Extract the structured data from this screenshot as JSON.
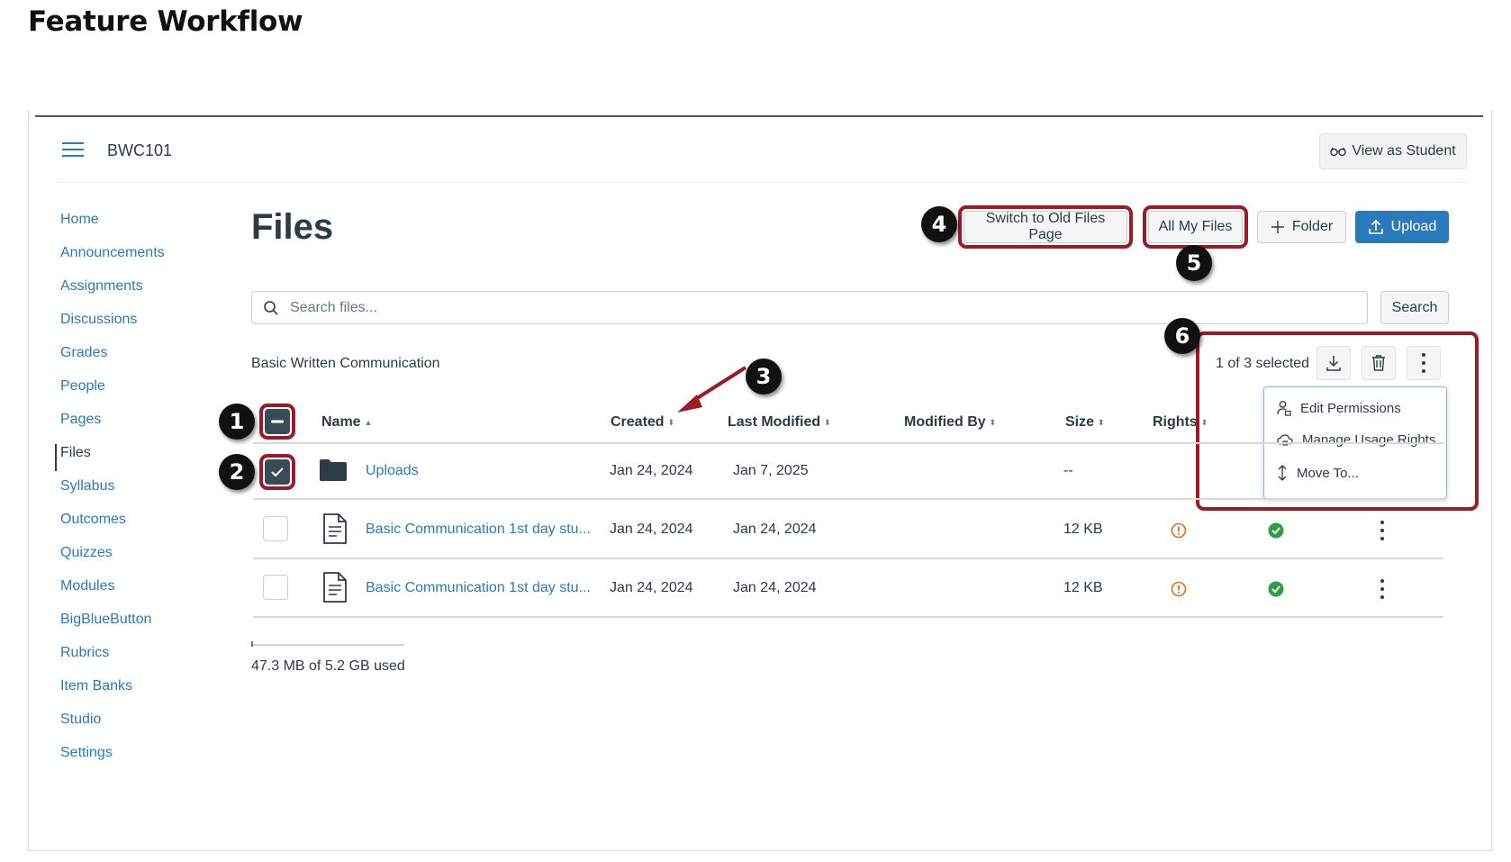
{
  "page": {
    "heading": "Feature Workflow"
  },
  "course": {
    "code": "BWC101"
  },
  "header": {
    "view_as_student": "View as Student"
  },
  "nav": {
    "items": [
      {
        "label": "Home"
      },
      {
        "label": "Announcements"
      },
      {
        "label": "Assignments"
      },
      {
        "label": "Discussions"
      },
      {
        "label": "Grades"
      },
      {
        "label": "People"
      },
      {
        "label": "Pages"
      },
      {
        "label": "Files",
        "active": true
      },
      {
        "label": "Syllabus"
      },
      {
        "label": "Outcomes"
      },
      {
        "label": "Quizzes"
      },
      {
        "label": "Modules"
      },
      {
        "label": "BigBlueButton"
      },
      {
        "label": "Rubrics"
      },
      {
        "label": "Item Banks"
      },
      {
        "label": "Studio"
      },
      {
        "label": "Settings"
      }
    ]
  },
  "files": {
    "title": "Files",
    "buttons": {
      "switch_old": "Switch to Old Files Page",
      "all_my_files": "All My Files",
      "folder": "Folder",
      "upload": "Upload"
    },
    "search": {
      "placeholder": "Search files...",
      "button": "Search"
    },
    "context_label": "Basic Written Communication",
    "selection": {
      "text": "1 of 3 selected"
    },
    "columns": {
      "name": "Name",
      "created": "Created",
      "last_modified": "Last Modified",
      "modified_by": "Modified By",
      "size": "Size",
      "rights": "Rights"
    },
    "rows": [
      {
        "name": "Uploads",
        "type": "folder",
        "created": "Jan 24, 2024",
        "last_modified": "Jan 7, 2025",
        "size": "--",
        "checked": true
      },
      {
        "name": "Basic Communication 1st day stu...",
        "type": "file",
        "created": "Jan 24, 2024",
        "last_modified": "Jan 24, 2024",
        "size": "12 KB",
        "checked": false
      },
      {
        "name": "Basic Communication 1st day stu...",
        "type": "file",
        "created": "Jan 24, 2024",
        "last_modified": "Jan 24, 2024",
        "size": "12 KB",
        "checked": false
      }
    ],
    "menu": {
      "items": [
        {
          "label": "Edit Permissions",
          "icon": "person-lock-icon"
        },
        {
          "label": "Manage Usage Rights",
          "icon": "cloud-lock-icon"
        },
        {
          "label": "Move To...",
          "icon": "move-arrows-icon"
        }
      ]
    },
    "storage": {
      "text": "47.3 MB of 5.2 GB used",
      "used_fraction": 0.009
    }
  },
  "callouts": [
    "1",
    "2",
    "3",
    "4",
    "5",
    "6"
  ],
  "colors": {
    "brand_blue": "#2b7abc",
    "text": "#2d3b45",
    "highlight": "#9b1c24",
    "warning": "#e86b1f",
    "success": "#2f9e44"
  }
}
